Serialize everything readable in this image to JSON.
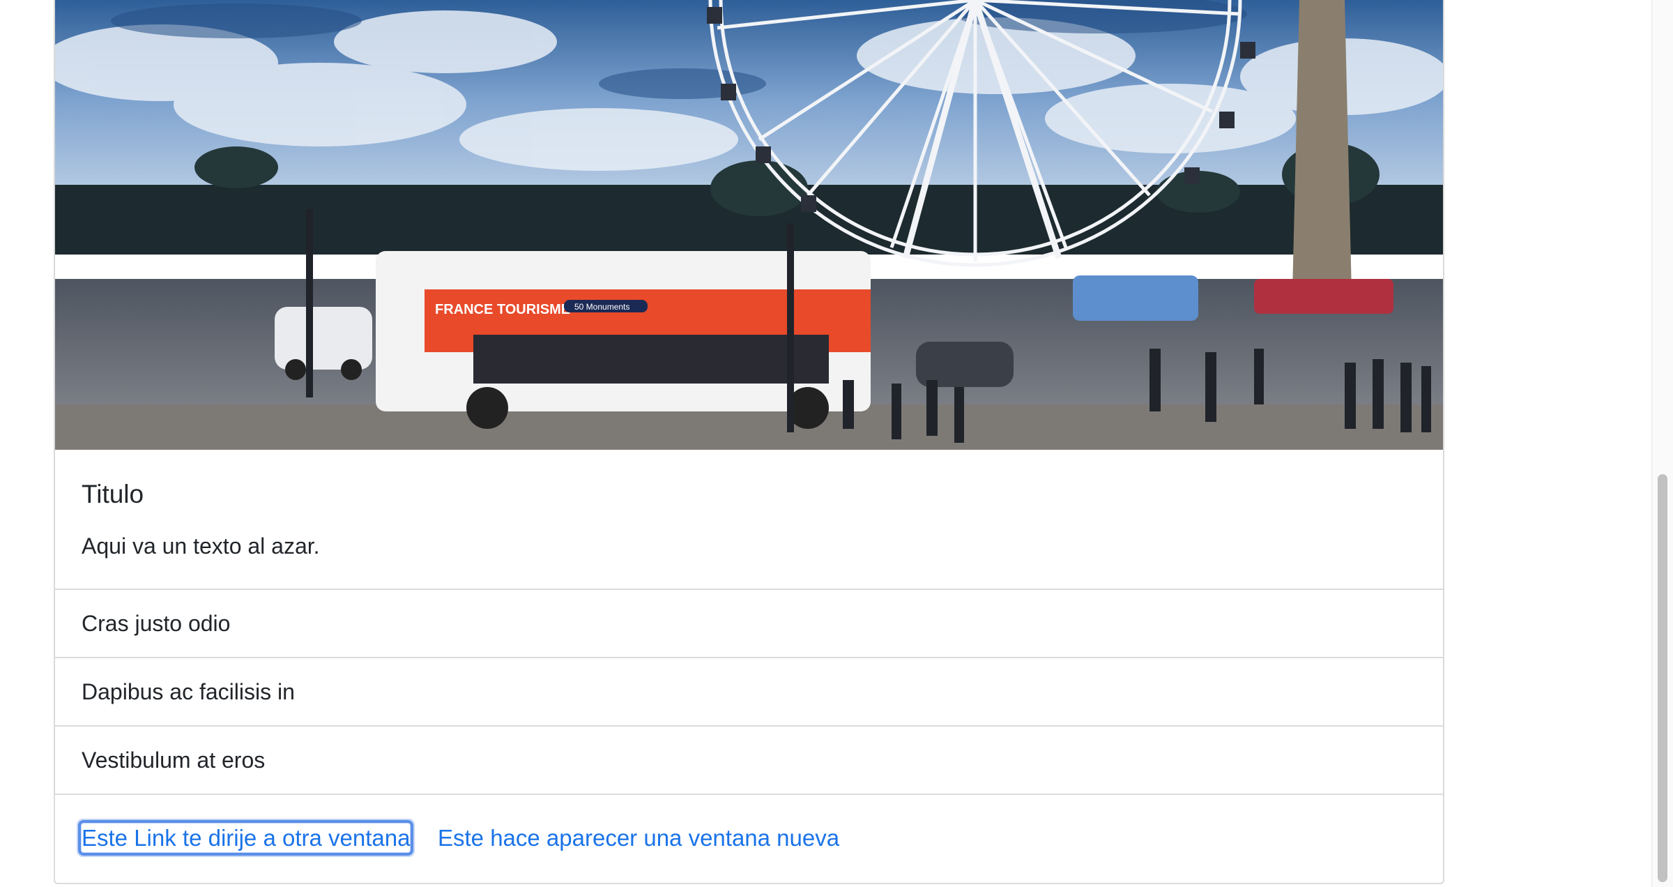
{
  "card": {
    "image_alt": "Ferris wheel at Place de la Concorde with a tour bus",
    "bus_text_1": "FRANCE TOURISME",
    "bus_text_2": "50 Monuments",
    "title": "Titulo",
    "text": "Aqui va un texto al azar."
  },
  "list": [
    {
      "label": "Cras justo odio"
    },
    {
      "label": "Dapibus ac facilisis in"
    },
    {
      "label": "Vestibulum at eros"
    }
  ],
  "links": {
    "link1": "Este Link te dirije a otra ventana",
    "link2": "Este hace aparecer una ventana nueva"
  },
  "colors": {
    "link": "#1a73e8",
    "focus": "#5b8fe8"
  }
}
